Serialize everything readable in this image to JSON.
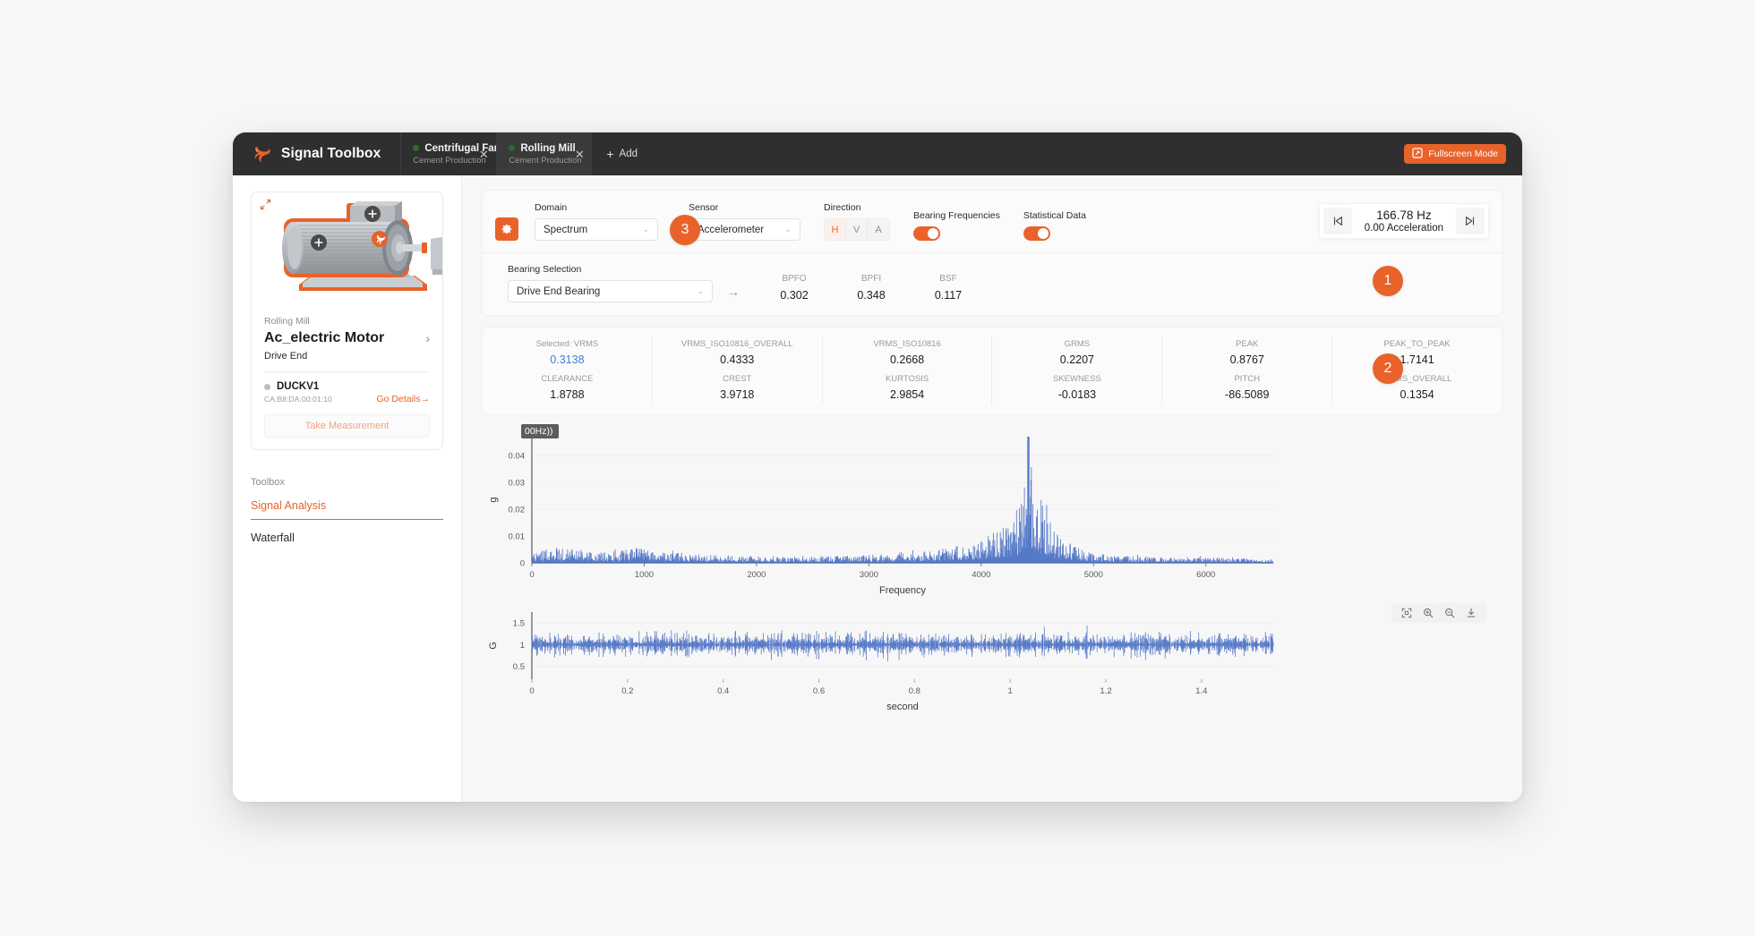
{
  "titlebar": {
    "brand": "Signal Toolbox",
    "add_label": "Add",
    "fullscreen_label": "Fullscreen Mode",
    "tabs": [
      {
        "title": "Centrifugal Fan",
        "subtitle": "Cement Production",
        "active": false
      },
      {
        "title": "Rolling Mill",
        "subtitle": "Cement Production",
        "active": true
      }
    ]
  },
  "sidebar": {
    "asset_group": "Rolling Mill",
    "asset_name": "Ac_electric Motor",
    "asset_location": "Drive End",
    "sensor_name": "DUCKV1",
    "sensor_mac": "CA:B8:DA:00:01:10",
    "go_details": "Go Details→",
    "take_measurement": "Take Measurement",
    "toolbox_title": "Toolbox",
    "tools": [
      {
        "label": "Signal Analysis",
        "active": true
      },
      {
        "label": "Waterfall",
        "active": false
      }
    ]
  },
  "controls": {
    "domain": {
      "label": "Domain",
      "value": "Spectrum"
    },
    "sensor": {
      "label": "Sensor",
      "value": "Accelerometer"
    },
    "direction": {
      "label": "Direction",
      "options": [
        "H",
        "V",
        "A"
      ],
      "selected": "H"
    },
    "bearing_frequencies": {
      "label": "Bearing Frequencies",
      "on": true
    },
    "statistical_data": {
      "label": "Statistical Data",
      "on": true
    },
    "cursor": {
      "frequency": "166.78 Hz",
      "acceleration": "0.00 Acceleration",
      "prev_icon": "skip-previous-icon",
      "next_icon": "skip-next-icon"
    }
  },
  "bearing": {
    "label": "Bearing Selection",
    "value": "Drive End Bearing",
    "stats": [
      {
        "key": "BPFO",
        "value": "0.302"
      },
      {
        "key": "BPFI",
        "value": "0.348"
      },
      {
        "key": "BSF",
        "value": "0.117"
      }
    ]
  },
  "statistics": {
    "row1": [
      {
        "key": "Selected: VRMS",
        "value": "0.3138",
        "selected": true
      },
      {
        "key": "VRMS_ISO10816_OVERALL",
        "value": "0.4333",
        "selected": false
      },
      {
        "key": "VRMS_ISO10816",
        "value": "0.2668",
        "selected": false
      },
      {
        "key": "GRMS",
        "value": "0.2207",
        "selected": false
      },
      {
        "key": "PEAK",
        "value": "0.8767",
        "selected": false
      },
      {
        "key": "PEAK_TO_PEAK",
        "value": "1.7141",
        "selected": false
      }
    ],
    "row2": [
      {
        "key": "CLEARANCE",
        "value": "1.8788",
        "selected": false
      },
      {
        "key": "CREST",
        "value": "3.9718",
        "selected": false
      },
      {
        "key": "KURTOSIS",
        "value": "2.9854",
        "selected": false
      },
      {
        "key": "SKEWNESS",
        "value": "-0.0183",
        "selected": false
      },
      {
        "key": "PITCH",
        "value": "-86.5089",
        "selected": false
      },
      {
        "key": "GRMS_OVERALL",
        "value": "0.1354",
        "selected": false
      }
    ]
  },
  "badges": [
    {
      "label": "1"
    },
    {
      "label": "2"
    },
    {
      "label": "3"
    }
  ],
  "chart_toolbar": [
    {
      "icon": "reset-zoom-icon"
    },
    {
      "icon": "zoom-in-icon"
    },
    {
      "icon": "zoom-out-icon"
    },
    {
      "icon": "download-icon"
    }
  ],
  "spectrum_tooltip": "00Hz))",
  "colors": {
    "accent": "#e8622a",
    "series": "#4c72c4",
    "selected_value": "#3f7fd6",
    "titlebar": "#2f2f2f"
  },
  "chart_data": [
    {
      "type": "line",
      "name": "spectrum",
      "title": "",
      "xlabel": "Frequency",
      "ylabel": "g",
      "xlim": [
        0,
        6600
      ],
      "ylim": [
        0,
        0.047
      ],
      "xticks": [
        0,
        1000,
        2000,
        3000,
        4000,
        5000,
        6000
      ],
      "yticks": [
        0,
        0.01,
        0.02,
        0.03,
        0.04
      ],
      "grid": true,
      "legend": "none",
      "peak": {
        "x": 4420,
        "y": 0.047
      },
      "noise_floor": 0.0012,
      "annotation": "00Hz))",
      "envelope": [
        {
          "x": 0,
          "y": 0.0035
        },
        {
          "x": 150,
          "y": 0.0055
        },
        {
          "x": 320,
          "y": 0.006
        },
        {
          "x": 520,
          "y": 0.004
        },
        {
          "x": 760,
          "y": 0.0042
        },
        {
          "x": 900,
          "y": 0.0065
        },
        {
          "x": 1080,
          "y": 0.004
        },
        {
          "x": 1250,
          "y": 0.0048
        },
        {
          "x": 1400,
          "y": 0.0032
        },
        {
          "x": 1600,
          "y": 0.003
        },
        {
          "x": 1850,
          "y": 0.0028
        },
        {
          "x": 2100,
          "y": 0.0025
        },
        {
          "x": 2400,
          "y": 0.0024
        },
        {
          "x": 2700,
          "y": 0.0026
        },
        {
          "x": 3000,
          "y": 0.003
        },
        {
          "x": 3250,
          "y": 0.004
        },
        {
          "x": 3500,
          "y": 0.0045
        },
        {
          "x": 3750,
          "y": 0.006
        },
        {
          "x": 3950,
          "y": 0.008
        },
        {
          "x": 4100,
          "y": 0.011
        },
        {
          "x": 4250,
          "y": 0.016
        },
        {
          "x": 4350,
          "y": 0.023
        },
        {
          "x": 4420,
          "y": 0.047
        },
        {
          "x": 4500,
          "y": 0.025
        },
        {
          "x": 4600,
          "y": 0.017
        },
        {
          "x": 4700,
          "y": 0.011
        },
        {
          "x": 4850,
          "y": 0.0065
        },
        {
          "x": 5000,
          "y": 0.0035
        },
        {
          "x": 5250,
          "y": 0.0026
        },
        {
          "x": 5600,
          "y": 0.0022
        },
        {
          "x": 6000,
          "y": 0.002
        },
        {
          "x": 6400,
          "y": 0.0018
        },
        {
          "x": 6600,
          "y": 0.0016
        }
      ]
    },
    {
      "type": "line",
      "name": "waveform",
      "title": "",
      "xlabel": "second",
      "ylabel": "G",
      "xlim": [
        0,
        1.55
      ],
      "ylim": [
        0.2,
        1.75
      ],
      "xticks": [
        0,
        0.2,
        0.4,
        0.6,
        0.8,
        1,
        1.2,
        1.4
      ],
      "yticks": [
        0.5,
        1,
        1.5
      ],
      "grid": true,
      "legend": "none",
      "mean": 1.0,
      "amplitude": 0.38
    }
  ]
}
